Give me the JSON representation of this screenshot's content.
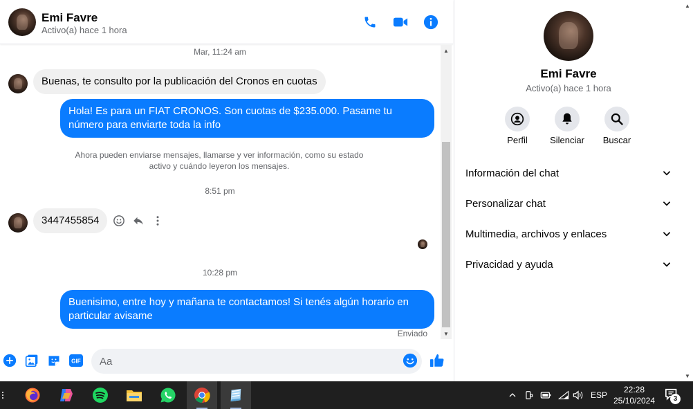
{
  "contact": {
    "name": "Emi Favre",
    "status": "Activo(a) hace 1 hora"
  },
  "header_actions": [
    "phone-icon",
    "video-icon",
    "info-icon"
  ],
  "accent_color": "#0a7cff",
  "messages": {
    "ts1": "Mar, 11:24 am",
    "m1": "Buenas, te consulto por la publicación del Cronos en cuotas",
    "m2": "Hola! Es para un FIAT CRONOS. Son cuotas de $235.000. Pasame tu número para enviarte toda la info",
    "notice": "Ahora pueden enviarse mensajes, llamarse y ver información, como su estado activo y cuándo leyeron los mensajes.",
    "ts2": "8:51 pm",
    "m3": "3447455854",
    "ts3": "10:28 pm",
    "m4": "Buenisimo, entre hoy y mañana te contactamos! Si tenés algún horario en particular avisame",
    "sent": "Enviado"
  },
  "composer": {
    "placeholder": "Aa",
    "gif_label": "GIF"
  },
  "sidebar": {
    "actions": [
      {
        "label": "Perfil",
        "icon": "profile-icon"
      },
      {
        "label": "Silenciar",
        "icon": "bell-icon"
      },
      {
        "label": "Buscar",
        "icon": "search-icon"
      }
    ],
    "sections": [
      "Información del chat",
      "Personalizar chat",
      "Multimedia, archivos y enlaces",
      "Privacidad y ayuda"
    ]
  },
  "taskbar": {
    "apps": [
      "firefox",
      "copilot",
      "spotify",
      "file-explorer",
      "whatsapp",
      "chrome",
      "notes"
    ],
    "language": "ESP",
    "time": "22:28",
    "date": "25/10/2024",
    "notifications": "3"
  }
}
